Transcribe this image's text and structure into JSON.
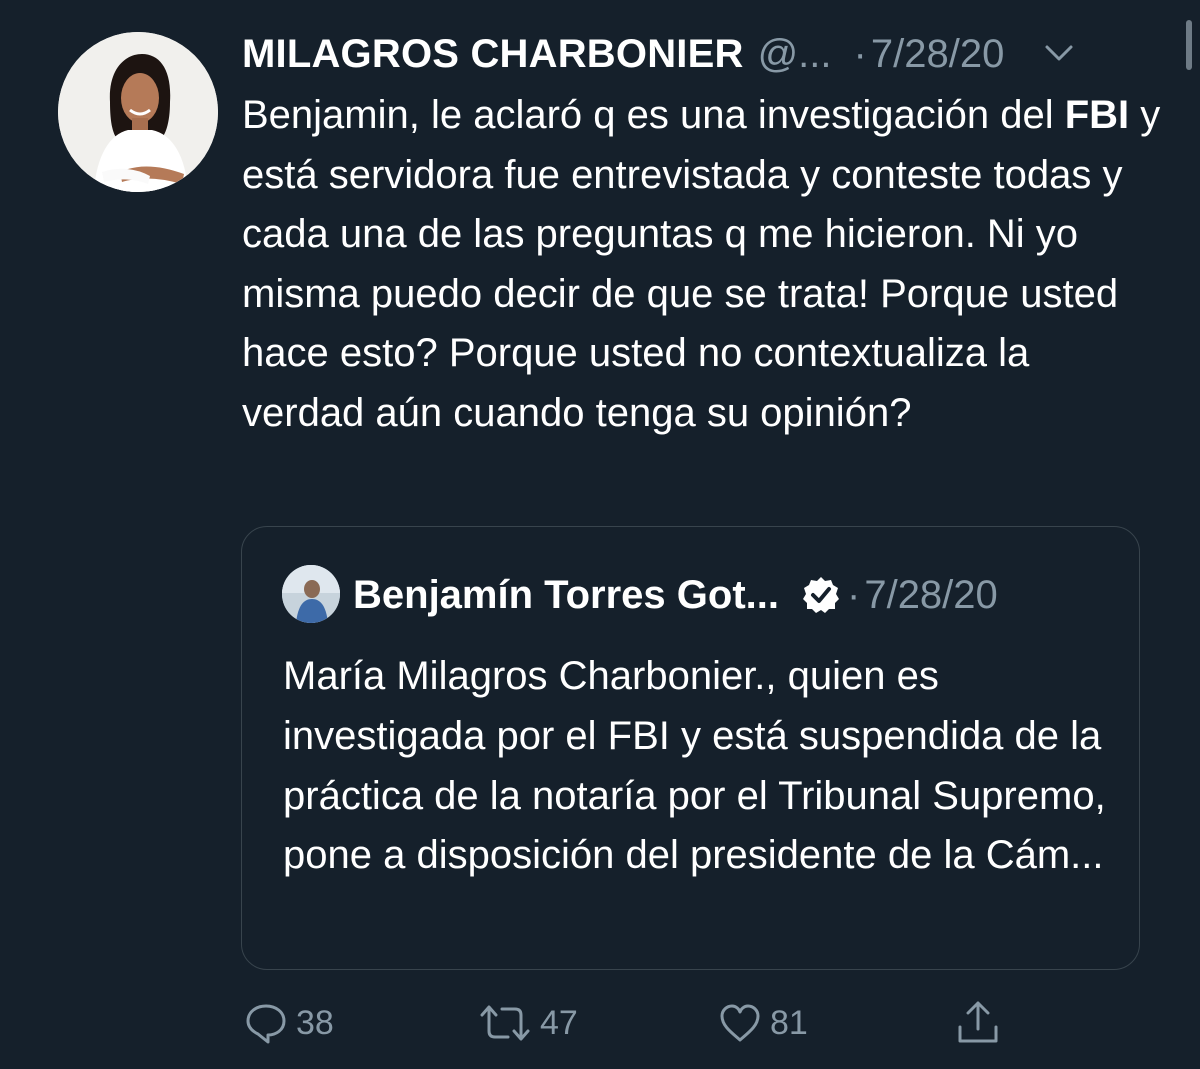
{
  "tweet": {
    "author_name": "MILAGROS CHARBONIER",
    "author_handle": "@...",
    "separator": "·",
    "date": "7/28/20",
    "avatar_icon": "profile-photo",
    "menu_icon": "chevron-down-icon",
    "text_parts": {
      "p1": "Benjamin, le aclaró q es una investigación del ",
      "bold": "FBI",
      "p2": " y está servidora fue entrevistada y conteste todas y cada una de las preguntas q me hicieron. Ni yo misma puedo decir de que se trata! Porque usted hace esto? Porque usted no contextualiza la verdad aún cuando tenga su opinión?"
    }
  },
  "quoted_tweet": {
    "author_name": "Benjamín Torres Got...",
    "verified_icon": "verified-badge-icon",
    "separator": "·",
    "date": "7/28/20",
    "text": "María Milagros Charbonier., quien es investigada por el FBI y está suspendida de la práctica de la notaría por el Tribunal Supremo, pone a disposición del presidente de la Cám..."
  },
  "actions": {
    "replies": "38",
    "retweets": "47",
    "likes": "81"
  },
  "colors": {
    "background": "#15202b",
    "text": "#ffffff",
    "muted": "#8899a6",
    "border": "#38444d"
  }
}
